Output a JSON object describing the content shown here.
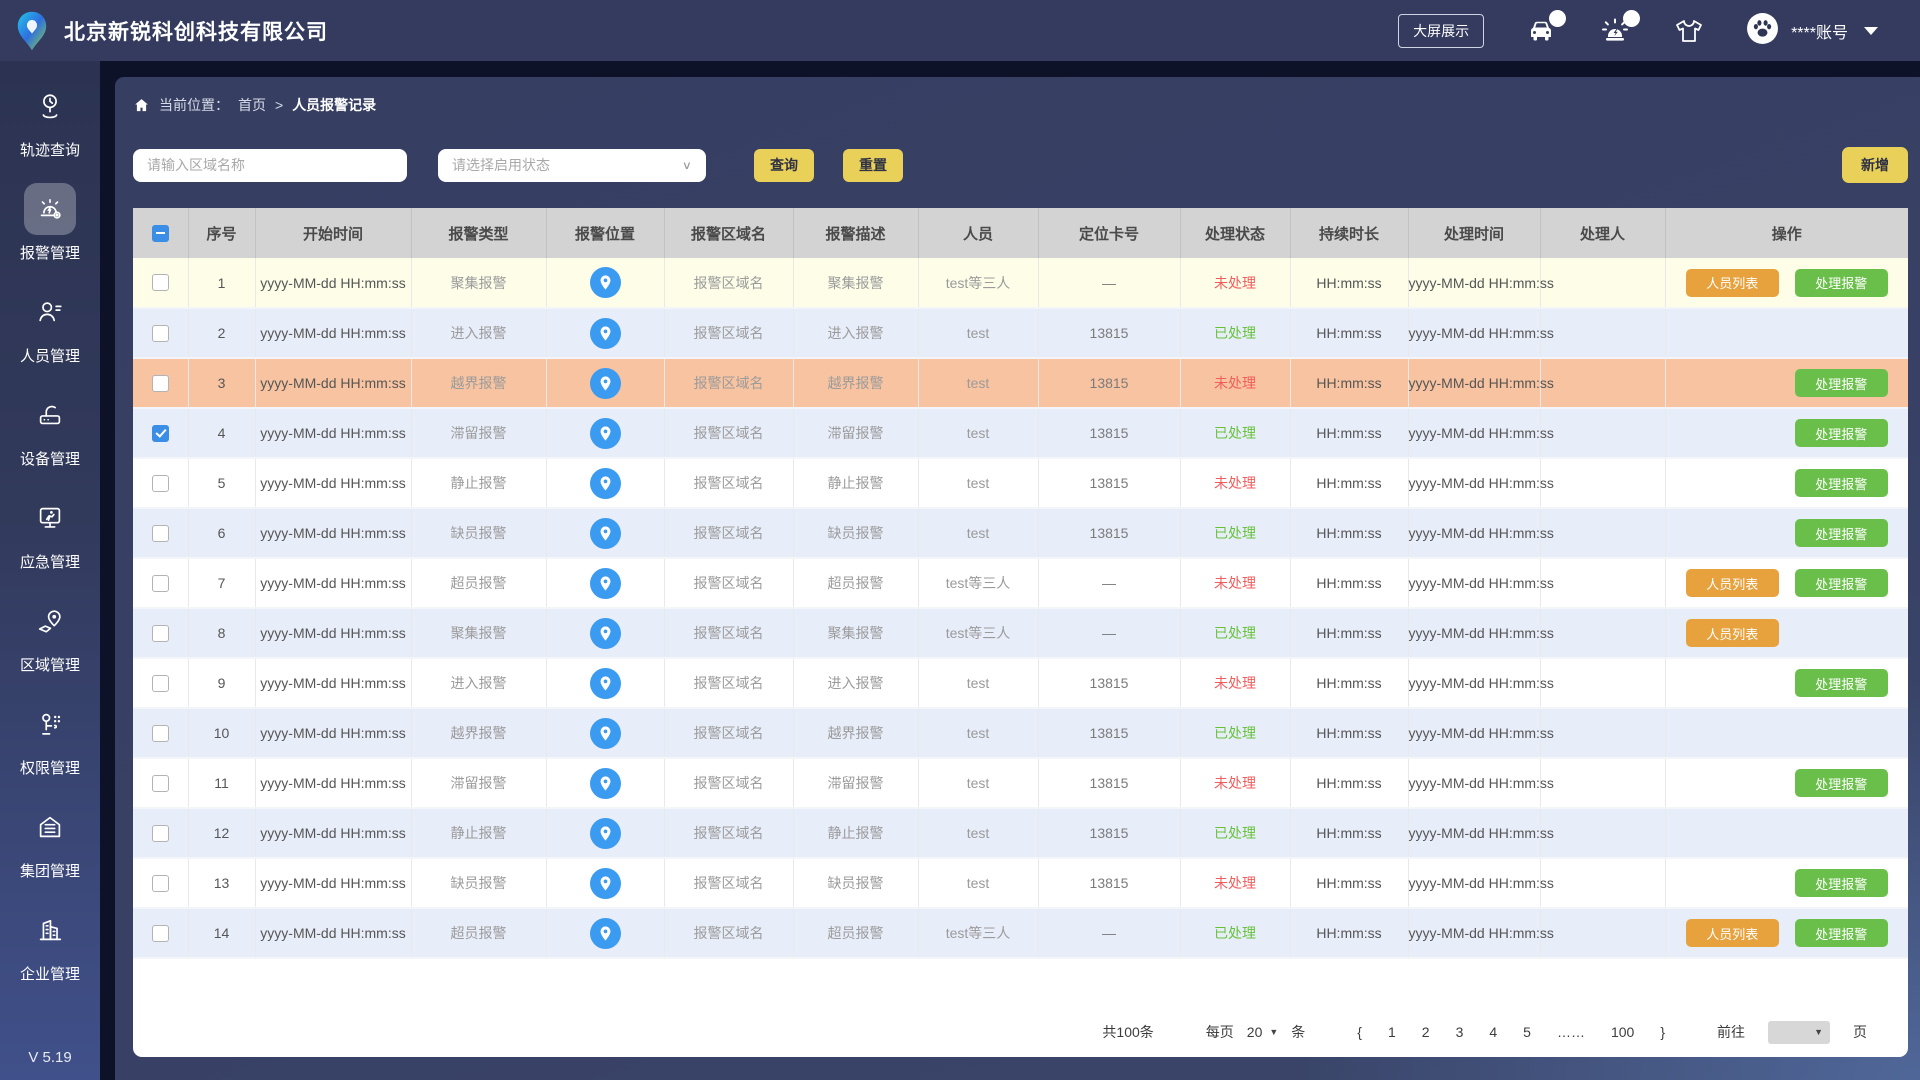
{
  "colors": {
    "header_bg": "#343b5e",
    "accent_yellow": "#e9d159",
    "status_pending": "#f25c5c",
    "status_done": "#67c23a",
    "btn_orange": "#e7a23d",
    "btn_green": "#6abf4b",
    "location_blue": "#3b9bf0",
    "cb_blue": "#3a8ee6"
  },
  "header": {
    "company": "北京新锐科创科技有限公司",
    "bigscreen_label": "大屏展示",
    "account": "****账号",
    "icons": [
      "vehicle-icon",
      "siren-icon",
      "shirt-icon",
      "paw-avatar-icon"
    ]
  },
  "sidebar": {
    "items": [
      {
        "label": "轨迹查询",
        "icon": "trajectory-icon",
        "active": false
      },
      {
        "label": "报警管理",
        "icon": "alarm-manage-icon",
        "active": true
      },
      {
        "label": "人员管理",
        "icon": "person-manage-icon",
        "active": false
      },
      {
        "label": "设备管理",
        "icon": "device-manage-icon",
        "active": false
      },
      {
        "label": "应急管理",
        "icon": "emergency-manage-icon",
        "active": false
      },
      {
        "label": "区域管理",
        "icon": "region-manage-icon",
        "active": false
      },
      {
        "label": "权限管理",
        "icon": "permission-manage-icon",
        "active": false
      },
      {
        "label": "集团管理",
        "icon": "group-manage-icon",
        "active": false
      },
      {
        "label": "企业管理",
        "icon": "enterprise-manage-icon",
        "active": false
      }
    ],
    "version": "V 5.19"
  },
  "breadcrumb": {
    "prefix": "当前位置：",
    "home": "首页",
    "separator": ">",
    "current": "人员报警记录"
  },
  "filters": {
    "area_placeholder": "请输入区域名称",
    "status_placeholder": "请选择启用状态",
    "query_label": "查询",
    "reset_label": "重置",
    "add_label": "新增"
  },
  "table": {
    "columns": [
      "序号",
      "开始时间",
      "报警类型",
      "报警位置",
      "报警区域名",
      "报警描述",
      "人员",
      "定位卡号",
      "处理状态",
      "持续时长",
      "处理时间",
      "处理人",
      "操作"
    ],
    "location_icon": "location-pin-icon",
    "action_list_label": "人员列表",
    "action_handle_label": "处理报警",
    "rows": [
      {
        "no": "1",
        "start": "yyyy-MM-dd HH:mm:ss",
        "type": "聚集报警",
        "area": "报警区域名",
        "desc": "聚集报警",
        "person": "test等三人",
        "card": "—",
        "status": "未处理",
        "handled": false,
        "duration": "HH:mm:ss",
        "handled_at": "yyyy-MM-dd HH:mm:ss",
        "handler": "",
        "show_list": true,
        "show_handle": true,
        "checked": false,
        "bg": "yellow"
      },
      {
        "no": "2",
        "start": "yyyy-MM-dd HH:mm:ss",
        "type": "进入报警",
        "area": "报警区域名",
        "desc": "进入报警",
        "person": "test",
        "card": "13815",
        "status": "已处理",
        "handled": true,
        "duration": "HH:mm:ss",
        "handled_at": "yyyy-MM-dd HH:mm:ss",
        "handler": "",
        "show_list": false,
        "show_handle": false,
        "checked": false,
        "bg": "stripe"
      },
      {
        "no": "3",
        "start": "yyyy-MM-dd HH:mm:ss",
        "type": "越界报警",
        "area": "报警区域名",
        "desc": "越界报警",
        "person": "test",
        "card": "13815",
        "status": "未处理",
        "handled": false,
        "duration": "HH:mm:ss",
        "handled_at": "yyyy-MM-dd HH:mm:ss",
        "handler": "",
        "show_list": false,
        "show_handle": true,
        "checked": false,
        "bg": "salmon"
      },
      {
        "no": "4",
        "start": "yyyy-MM-dd HH:mm:ss",
        "type": "滞留报警",
        "area": "报警区域名",
        "desc": "滞留报警",
        "person": "test",
        "card": "13815",
        "status": "已处理",
        "handled": true,
        "duration": "HH:mm:ss",
        "handled_at": "yyyy-MM-dd HH:mm:ss",
        "handler": "",
        "show_list": false,
        "show_handle": true,
        "checked": true,
        "bg": "stripe"
      },
      {
        "no": "5",
        "start": "yyyy-MM-dd HH:mm:ss",
        "type": "静止报警",
        "area": "报警区域名",
        "desc": "静止报警",
        "person": "test",
        "card": "13815",
        "status": "未处理",
        "handled": false,
        "duration": "HH:mm:ss",
        "handled_at": "yyyy-MM-dd HH:mm:ss",
        "handler": "",
        "show_list": false,
        "show_handle": true,
        "checked": false,
        "bg": "white"
      },
      {
        "no": "6",
        "start": "yyyy-MM-dd HH:mm:ss",
        "type": "缺员报警",
        "area": "报警区域名",
        "desc": "缺员报警",
        "person": "test",
        "card": "13815",
        "status": "已处理",
        "handled": true,
        "duration": "HH:mm:ss",
        "handled_at": "yyyy-MM-dd HH:mm:ss",
        "handler": "",
        "show_list": false,
        "show_handle": true,
        "checked": false,
        "bg": "stripe"
      },
      {
        "no": "7",
        "start": "yyyy-MM-dd HH:mm:ss",
        "type": "超员报警",
        "area": "报警区域名",
        "desc": "超员报警",
        "person": "test等三人",
        "card": "—",
        "status": "未处理",
        "handled": false,
        "duration": "HH:mm:ss",
        "handled_at": "yyyy-MM-dd HH:mm:ss",
        "handler": "",
        "show_list": true,
        "show_handle": true,
        "checked": false,
        "bg": "white"
      },
      {
        "no": "8",
        "start": "yyyy-MM-dd HH:mm:ss",
        "type": "聚集报警",
        "area": "报警区域名",
        "desc": "聚集报警",
        "person": "test等三人",
        "card": "—",
        "status": "已处理",
        "handled": true,
        "duration": "HH:mm:ss",
        "handled_at": "yyyy-MM-dd HH:mm:ss",
        "handler": "",
        "show_list": true,
        "show_handle": false,
        "checked": false,
        "bg": "stripe"
      },
      {
        "no": "9",
        "start": "yyyy-MM-dd HH:mm:ss",
        "type": "进入报警",
        "area": "报警区域名",
        "desc": "进入报警",
        "person": "test",
        "card": "13815",
        "status": "未处理",
        "handled": false,
        "duration": "HH:mm:ss",
        "handled_at": "yyyy-MM-dd HH:mm:ss",
        "handler": "",
        "show_list": false,
        "show_handle": true,
        "checked": false,
        "bg": "white"
      },
      {
        "no": "10",
        "start": "yyyy-MM-dd HH:mm:ss",
        "type": "越界报警",
        "area": "报警区域名",
        "desc": "越界报警",
        "person": "test",
        "card": "13815",
        "status": "已处理",
        "handled": true,
        "duration": "HH:mm:ss",
        "handled_at": "yyyy-MM-dd HH:mm:ss",
        "handler": "",
        "show_list": false,
        "show_handle": false,
        "checked": false,
        "bg": "stripe"
      },
      {
        "no": "11",
        "start": "yyyy-MM-dd HH:mm:ss",
        "type": "滞留报警",
        "area": "报警区域名",
        "desc": "滞留报警",
        "person": "test",
        "card": "13815",
        "status": "未处理",
        "handled": false,
        "duration": "HH:mm:ss",
        "handled_at": "yyyy-MM-dd HH:mm:ss",
        "handler": "",
        "show_list": false,
        "show_handle": true,
        "checked": false,
        "bg": "white"
      },
      {
        "no": "12",
        "start": "yyyy-MM-dd HH:mm:ss",
        "type": "静止报警",
        "area": "报警区域名",
        "desc": "静止报警",
        "person": "test",
        "card": "13815",
        "status": "已处理",
        "handled": true,
        "duration": "HH:mm:ss",
        "handled_at": "yyyy-MM-dd HH:mm:ss",
        "handler": "",
        "show_list": false,
        "show_handle": false,
        "checked": false,
        "bg": "stripe"
      },
      {
        "no": "13",
        "start": "yyyy-MM-dd HH:mm:ss",
        "type": "缺员报警",
        "area": "报警区域名",
        "desc": "缺员报警",
        "person": "test",
        "card": "13815",
        "status": "未处理",
        "handled": false,
        "duration": "HH:mm:ss",
        "handled_at": "yyyy-MM-dd HH:mm:ss",
        "handler": "",
        "show_list": false,
        "show_handle": true,
        "checked": false,
        "bg": "white"
      },
      {
        "no": "14",
        "start": "yyyy-MM-dd HH:mm:ss",
        "type": "超员报警",
        "area": "报警区域名",
        "desc": "超员报警",
        "person": "test等三人",
        "card": "—",
        "status": "已处理",
        "handled": true,
        "duration": "HH:mm:ss",
        "handled_at": "yyyy-MM-dd HH:mm:ss",
        "handler": "",
        "show_list": true,
        "show_handle": true,
        "checked": false,
        "bg": "stripe"
      }
    ]
  },
  "pagination": {
    "total": "共100条",
    "per_page_prefix": "每页",
    "per_page_value": "20",
    "per_page_suffix": "条",
    "prev": "{",
    "next": "}",
    "pages": [
      "1",
      "2",
      "3",
      "4",
      "5"
    ],
    "ellipsis": "……",
    "last_page": "100",
    "goto_prefix": "前往",
    "goto_suffix": "页"
  }
}
